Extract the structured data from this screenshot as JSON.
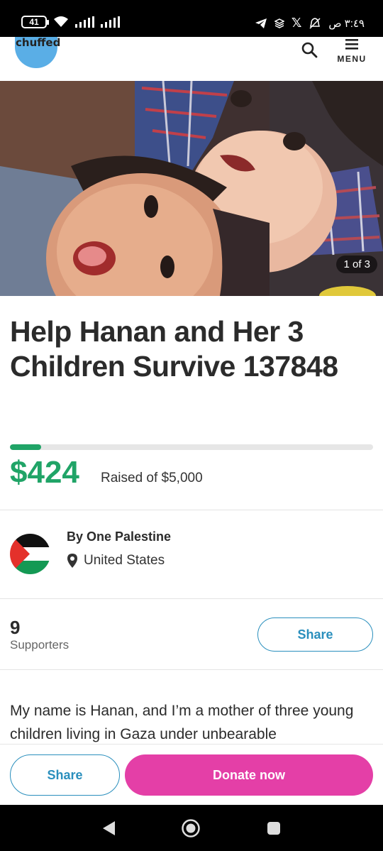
{
  "status_bar": {
    "battery": "41",
    "time": "٣:٤٩ ص"
  },
  "header": {
    "logo_text": "chuffed",
    "menu_label": "MENU"
  },
  "hero": {
    "photo_counter": "1 of 3"
  },
  "campaign": {
    "title": "Help Hanan and Her 3 Children Survive 137848",
    "progress_fraction": 0.085,
    "raised_amount": "$424",
    "raised_text": "Raised of $5,000"
  },
  "organizer": {
    "name": "By One Palestine",
    "location": "United States"
  },
  "supporters": {
    "count": "9",
    "label": "Supporters",
    "share_label": "Share"
  },
  "story": {
    "text": "My name is Hanan, and I’m a mother of three young children living in Gaza under unbearable"
  },
  "bottom_bar": {
    "share_label": "Share",
    "donate_label": "Donate now"
  },
  "colors": {
    "accent_green": "#20a467",
    "donate_pink": "#e43fa7",
    "share_blue": "#2a8fbd",
    "logo_blue": "#5aaee6"
  },
  "icons": [
    "search-icon",
    "menu-icon",
    "location-pin-icon",
    "palestine-flag",
    "back-icon",
    "home-icon",
    "recents-icon"
  ]
}
